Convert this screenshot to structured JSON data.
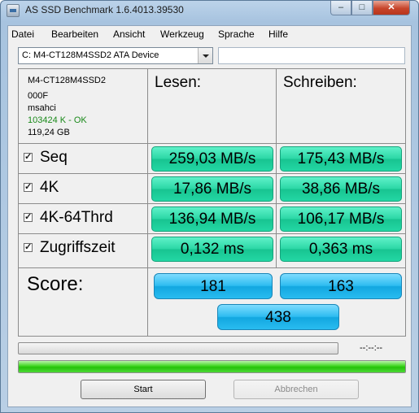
{
  "window": {
    "title": "AS SSD Benchmark 1.6.4013.39530",
    "controls": {
      "minimize": "–",
      "maximize": "□",
      "close": "✕"
    }
  },
  "menu": [
    "Datei",
    "Bearbeiten",
    "Ansicht",
    "Werkzeug",
    "Sprache",
    "Hilfe"
  ],
  "device": {
    "selected": "C: M4-CT128M4SSD2 ATA Device",
    "text_field": ""
  },
  "drive_info": {
    "model": "M4-CT128M4SSD2",
    "firmware": "000F",
    "driver": "msahci",
    "alignment": "103424 K - OK",
    "capacity": "119,24 GB"
  },
  "columns": {
    "read": "Lesen:",
    "write": "Schreiben:"
  },
  "rows": [
    {
      "label": "Seq",
      "checked": true,
      "read": "259,03 MB/s",
      "write": "175,43 MB/s"
    },
    {
      "label": "4K",
      "checked": true,
      "read": "17,86 MB/s",
      "write": "38,86 MB/s"
    },
    {
      "label": "4K-64Thrd",
      "checked": true,
      "read": "136,94 MB/s",
      "write": "106,17 MB/s"
    },
    {
      "label": "Zugriffszeit",
      "checked": true,
      "read": "0,132 ms",
      "write": "0,363 ms"
    }
  ],
  "score": {
    "label": "Score:",
    "read": "181",
    "write": "163",
    "total": "438"
  },
  "progress": {
    "time": "--:--:--",
    "current_fraction": 0.0,
    "overall_fraction": 1.0
  },
  "buttons": {
    "start": "Start",
    "abort": "Abbrechen"
  },
  "colors": {
    "value_box": "#2cd7a6",
    "score_box": "#2dbcf0",
    "progress_fill": "#3ed520",
    "ok_text": "#1a8a1a"
  }
}
